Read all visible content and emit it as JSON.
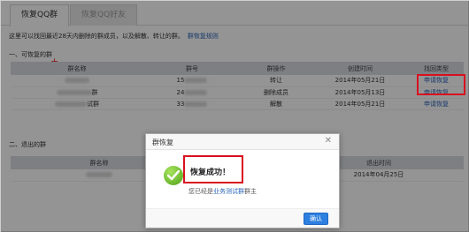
{
  "tabs": {
    "active": "恢复QQ群",
    "inactive": "恢复QQ好友"
  },
  "intro": {
    "text": "这里可以找回最近28天内删除的群成员，以及解散、转让的群。",
    "link": "群恢复规则"
  },
  "section1": {
    "title": "一、可恢复的群",
    "headers": [
      "群名称",
      "群号",
      "群操作",
      "创建时间",
      "找回类型"
    ],
    "rows": [
      {
        "name_suffix": "",
        "number_prefix": "15",
        "op": "转让",
        "date": "2014年05月21日",
        "action": "申请恢复"
      },
      {
        "name_suffix": "群",
        "number_prefix": "24",
        "op": "删除成员",
        "date": "2014年05月13日",
        "action": "申请恢复"
      },
      {
        "name_suffix": "试群",
        "number_prefix": "33",
        "op": "解散",
        "date": "2014年05月21日",
        "action": "申请恢复"
      }
    ]
  },
  "section2": {
    "title": "二、退出的群",
    "headers": [
      "群名称",
      "",
      "退出时间"
    ],
    "rows": [
      {
        "date": "2014年04月25日"
      }
    ]
  },
  "dialog": {
    "title": "群恢复",
    "message": "恢复成功！",
    "sub_prefix": "您已经是",
    "group_name": "业务测试群",
    "sub_suffix": "群主",
    "ok": "确认",
    "close_symbol": "✕"
  },
  "colors": {
    "link": "#2b64b9",
    "highlight": "#d9101f",
    "button": "#2d7fe0"
  }
}
